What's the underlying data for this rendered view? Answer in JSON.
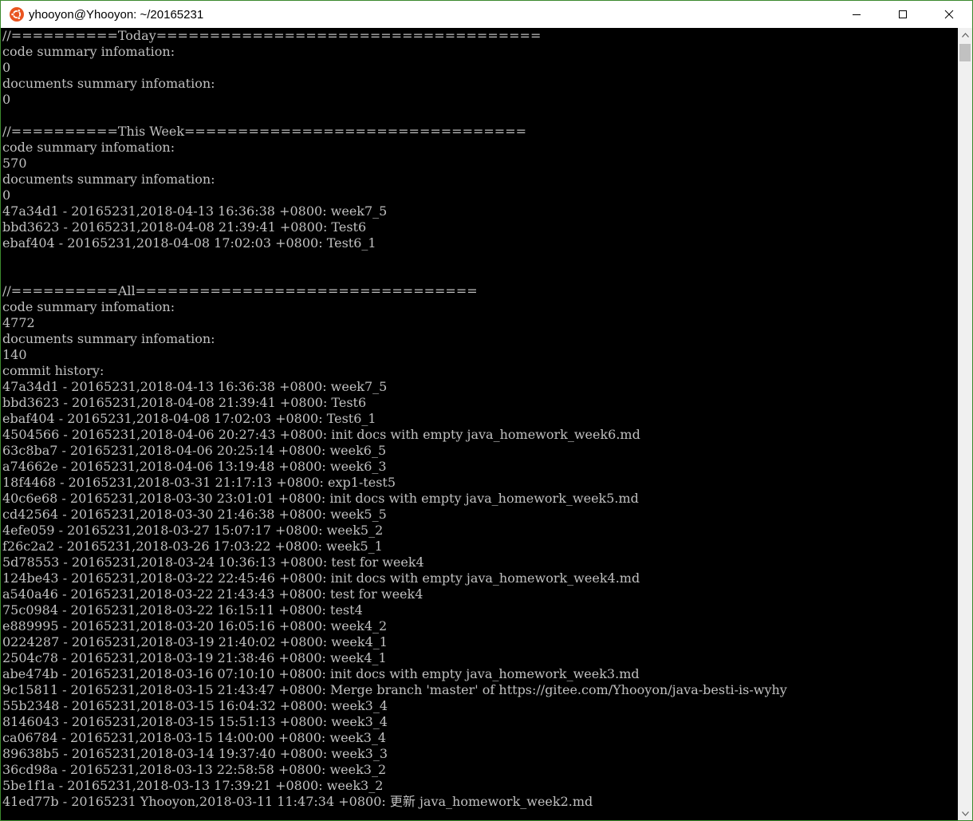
{
  "window": {
    "title": "yhooyon@Yhooyon: ~/20165231",
    "icon": "ubuntu-icon",
    "accent": "#e95420"
  },
  "console_lines": [
    "//==========Today====================================",
    "code summary infomation:",
    "0",
    "documents summary infomation:",
    "0",
    "",
    "//==========This Week================================",
    "code summary infomation:",
    "570",
    "documents summary infomation:",
    "0",
    "47a34d1 - 20165231,2018-04-13 16:36:38 +0800: week7_5",
    "bbd3623 - 20165231,2018-04-08 21:39:41 +0800: Test6",
    "ebaf404 - 20165231,2018-04-08 17:02:03 +0800: Test6_1",
    "",
    "",
    "//==========All================================",
    "code summary infomation:",
    "4772",
    "documents summary infomation:",
    "140",
    "commit history:",
    "47a34d1 - 20165231,2018-04-13 16:36:38 +0800: week7_5",
    "bbd3623 - 20165231,2018-04-08 21:39:41 +0800: Test6",
    "ebaf404 - 20165231,2018-04-08 17:02:03 +0800: Test6_1",
    "4504566 - 20165231,2018-04-06 20:27:43 +0800: init docs with empty java_homework_week6.md",
    "63c8ba7 - 20165231,2018-04-06 20:25:14 +0800: week6_5",
    "a74662e - 20165231,2018-04-06 13:19:48 +0800: week6_3",
    "18f4468 - 20165231,2018-03-31 21:17:13 +0800: exp1-test5",
    "40c6e68 - 20165231,2018-03-30 23:01:01 +0800: init docs with empty java_homework_week5.md",
    "cd42564 - 20165231,2018-03-30 21:46:38 +0800: week5_5",
    "4efe059 - 20165231,2018-03-27 15:07:17 +0800: week5_2",
    "f26c2a2 - 20165231,2018-03-26 17:03:22 +0800: week5_1",
    "5d78553 - 20165231,2018-03-24 10:36:13 +0800: test for week4",
    "124be43 - 20165231,2018-03-22 22:45:46 +0800: init docs with empty java_homework_week4.md",
    "a540a46 - 20165231,2018-03-22 21:43:43 +0800: test for week4",
    "75c0984 - 20165231,2018-03-22 16:15:11 +0800: test4",
    "e889995 - 20165231,2018-03-20 16:05:16 +0800: week4_2",
    "0224287 - 20165231,2018-03-19 21:40:02 +0800: week4_1",
    "2504c78 - 20165231,2018-03-19 21:38:46 +0800: week4_1",
    "abe474b - 20165231,2018-03-16 07:10:10 +0800: init docs with empty java_homework_week3.md",
    "9c15811 - 20165231,2018-03-15 21:43:47 +0800: Merge branch 'master' of https://gitee.com/Yhooyon/java-besti-is-wyhy",
    "55b2348 - 20165231,2018-03-15 16:04:32 +0800: week3_4",
    "8146043 - 20165231,2018-03-15 15:51:13 +0800: week3_4",
    "ca06784 - 20165231,2018-03-15 14:00:00 +0800: week3_4",
    "89638b5 - 20165231,2018-03-14 19:37:40 +0800: week3_3",
    "36cd98a - 20165231,2018-03-13 22:58:58 +0800: week3_2",
    "5be1f1a - 20165231,2018-03-13 17:39:21 +0800: week3_2",
    "41ed77b - 20165231 Yhooyon,2018-03-11 11:47:34 +0800: 更新 java_homework_week2.md"
  ]
}
